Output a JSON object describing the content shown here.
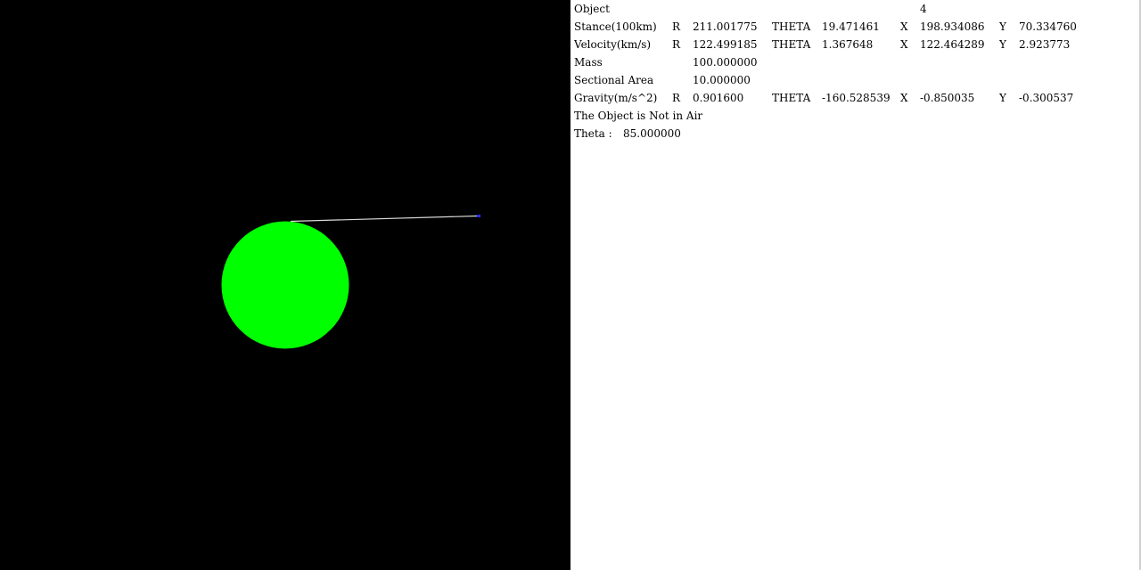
{
  "colors": {
    "space": "#000000",
    "planet": "#00ff00",
    "trajectory": "#d9d9d9",
    "object": "#2a2aff",
    "panel_bg": "#ffffff",
    "text": "#000000"
  },
  "panel": {
    "object": {
      "label": "Object",
      "value": "4"
    },
    "stance": {
      "label": "Stance(100km)",
      "r_label": "R",
      "r": "211.001775",
      "theta_label": "THETA",
      "theta": "19.471461",
      "x_label": "X",
      "x": "198.934086",
      "y_label": "Y",
      "y": "70.334760"
    },
    "velocity": {
      "label": "Velocity(km/s)",
      "r_label": "R",
      "r": "122.499185",
      "theta_label": "THETA",
      "theta": "1.367648",
      "x_label": "X",
      "x": "122.464289",
      "y_label": "Y",
      "y": "2.923773"
    },
    "mass": {
      "label": "Mass",
      "value": "100.000000"
    },
    "sectional_area": {
      "label": "Sectional Area",
      "value": "10.000000"
    },
    "gravity": {
      "label": "Gravity(m/s^2)",
      "r_label": "R",
      "r": "0.901600",
      "theta_label": "THETA",
      "theta": "-160.528539",
      "x_label": "X",
      "x": "-0.850035",
      "y_label": "Y",
      "y": "-0.300537"
    },
    "air_status": "The Object is Not in Air",
    "theta_input": {
      "label": "Theta :",
      "value": "85.000000"
    }
  }
}
